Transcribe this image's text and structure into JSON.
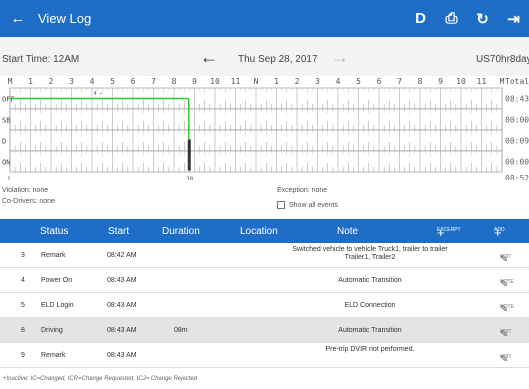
{
  "appbar": {
    "back_icon": "←",
    "title": "View Log",
    "actions": [
      {
        "icon": "D",
        "name": "d-icon"
      },
      {
        "icon": "⎙",
        "name": "print-icon"
      },
      {
        "icon": "↻",
        "name": "refresh-icon"
      },
      {
        "icon": "⇥",
        "name": "logout-icon"
      }
    ],
    "color": "#1e6ec8"
  },
  "datebar": {
    "start_time": "Start Time: 12AM",
    "prev_icon": "←",
    "date": "Thu Sep 28, 2017",
    "next_icon": "→",
    "cycle": "US70hr8days"
  },
  "graph": {
    "hour_labels": [
      "M",
      "1",
      "2",
      "3",
      "4",
      "5",
      "6",
      "7",
      "8",
      "9",
      "10",
      "11",
      "N",
      "1",
      "2",
      "3",
      "4",
      "5",
      "6",
      "7",
      "8",
      "9",
      "10",
      "11",
      "M"
    ],
    "total_header": "Total",
    "rows": [
      {
        "label": "OFF",
        "total": "08:43"
      },
      {
        "label": "SB",
        "total": "00:00"
      },
      {
        "label": "D",
        "total": "00:09"
      },
      {
        "label": "ON",
        "total": "00:00"
      }
    ],
    "grand_total": "08:52",
    "bottom_left": "1",
    "bottom_mark": "38",
    "top_marks": "4 ←",
    "status_line_color": "#2ecc2e"
  },
  "meta": {
    "violation": "Violation: none",
    "codrivers": "Co-Drivers: none",
    "exception": "Exception: none",
    "show_all": "Show all events"
  },
  "table": {
    "headers": {
      "status": "Status",
      "start": "Start",
      "duration": "Duration",
      "location": "Location",
      "note": "Note"
    },
    "excerpt_label": "EXCERPT",
    "add_label": "ADD",
    "rows": [
      {
        "idx": "3",
        "status": "Remark",
        "start": "08:42 AM",
        "duration": "",
        "note": "Switched vehicle to vehicle Truck1, trailer to trailer Trailer1, Trailer2",
        "btn": "EDIT"
      },
      {
        "idx": "4",
        "status": "Power On",
        "start": "08:43 AM",
        "duration": "",
        "note": "Automatic Transition",
        "btn": "NOTE"
      },
      {
        "idx": "5",
        "status": "ELD Login",
        "start": "08:43 AM",
        "duration": "",
        "note": "ELD Connection",
        "btn": "NOTE"
      },
      {
        "idx": "8",
        "status": "Driving",
        "start": "08:43 AM",
        "duration": "08m",
        "note": "Automatic Transition",
        "btn": "EDIT"
      },
      {
        "idx": "9",
        "status": "Remark",
        "start": "08:43 AM",
        "duration": "",
        "note": "Pre-trip DVIR not performed.",
        "btn": "EDIT"
      }
    ]
  },
  "legend": "+Inactive: IC=Changed, ICR=Change Requested, ICJ= Change Rejected"
}
